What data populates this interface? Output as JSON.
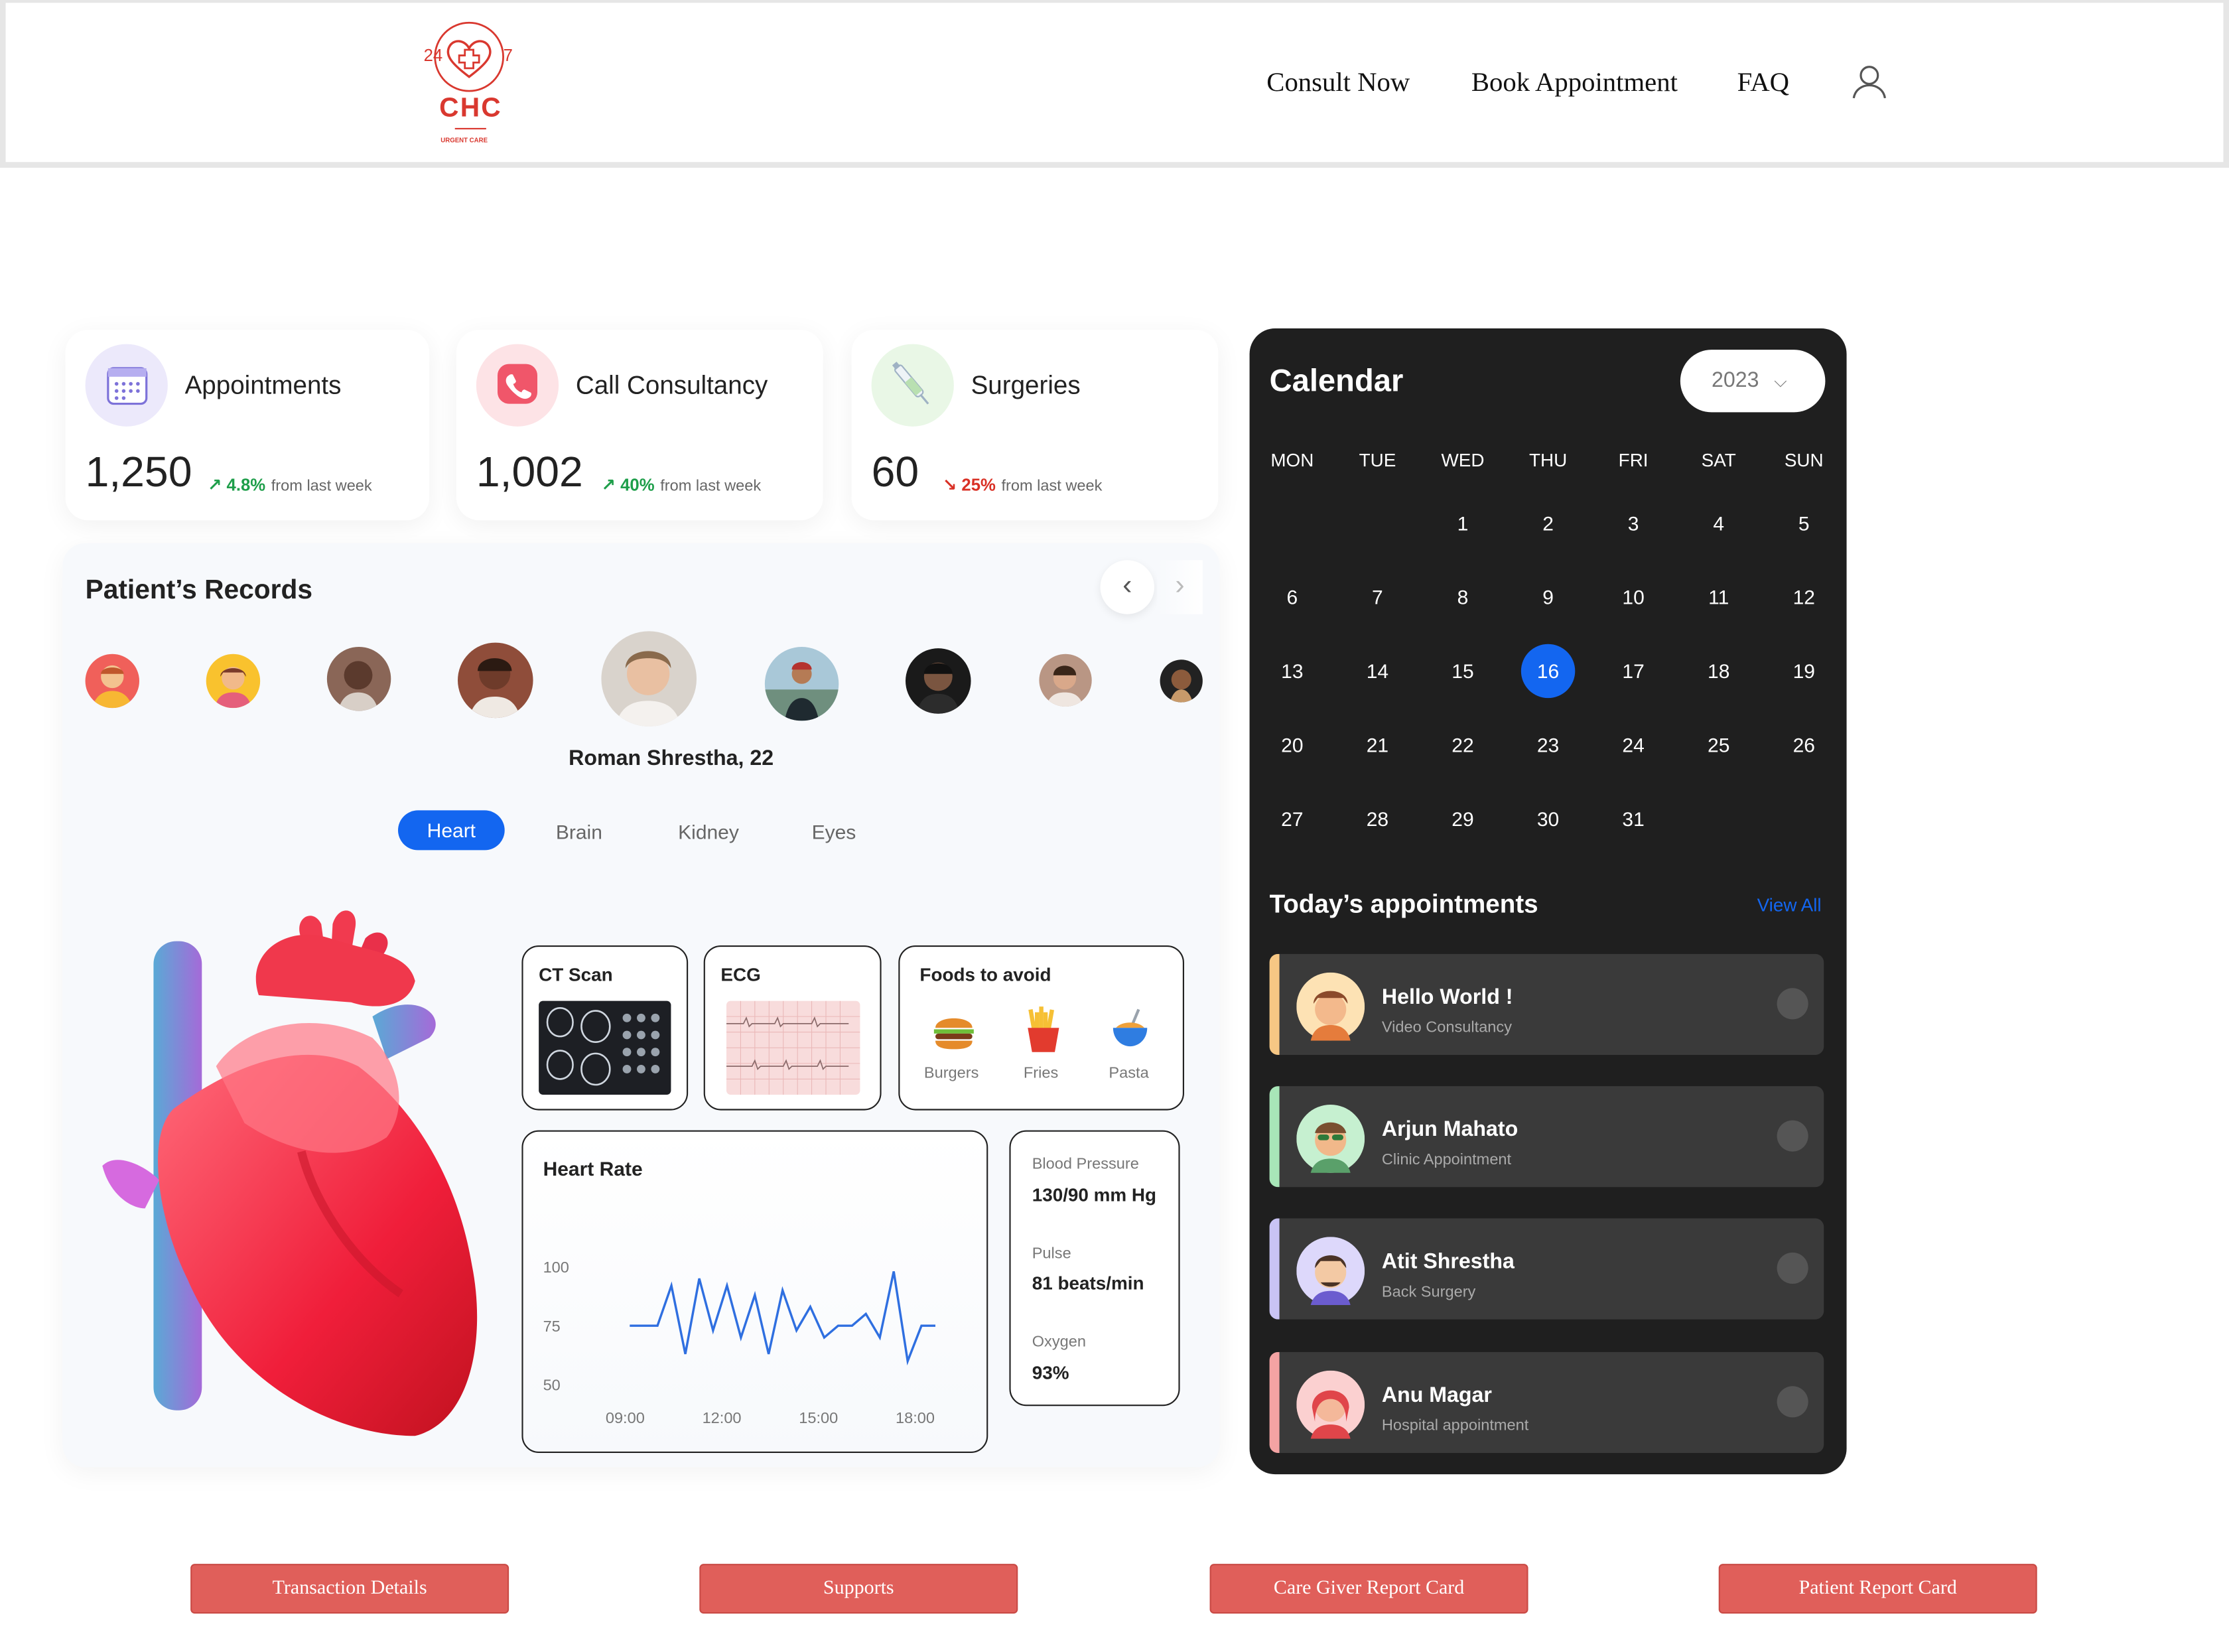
{
  "header": {
    "logo": {
      "top_left": "24",
      "top_right": "7",
      "brand": "CHC",
      "tagline": "URGENT CARE"
    },
    "nav": [
      "Consult Now",
      "Book Appointment",
      "FAQ"
    ],
    "user_icon": "user-icon"
  },
  "stats": [
    {
      "label": "Appointments",
      "value": "1,250",
      "change": "4.8%",
      "direction": "up",
      "note": "from last week",
      "icon": "calendar-icon",
      "color": "#1e9e4a"
    },
    {
      "label": "Call Consultancy",
      "value": "1,002",
      "change": "40%",
      "direction": "up",
      "note": "from last week",
      "icon": "phone-icon",
      "color": "#1e9e4a"
    },
    {
      "label": "Surgeries",
      "value": "60",
      "change": "25%",
      "direction": "down",
      "note": "from last week",
      "icon": "syringe-icon",
      "color": "#d93025"
    }
  ],
  "records": {
    "title": "Patient’s Records",
    "selected_patient": "Roman Shrestha, 22",
    "tabs": [
      "Heart",
      "Brain",
      "Kidney",
      "Eyes"
    ],
    "active_tab": "Heart",
    "ct_scan": "CT Scan",
    "ecg": "ECG",
    "foods": {
      "title": "Foods to avoid",
      "items": [
        "Burgers",
        "Fries",
        "Pasta"
      ]
    },
    "heart_rate": {
      "title": "Heart Rate"
    },
    "vitals": [
      {
        "label": "Blood Pressure",
        "value": "130/90 mm Hg"
      },
      {
        "label": "Pulse",
        "value": "81 beats/min"
      },
      {
        "label": "Oxygen",
        "value": "93%"
      }
    ]
  },
  "chart_data": {
    "type": "line",
    "title": "Heart Rate",
    "x_ticks": [
      "09:00",
      "12:00",
      "15:00",
      "18:00"
    ],
    "y_ticks": [
      100,
      75,
      50
    ],
    "ylim": [
      50,
      100
    ],
    "series": [
      {
        "values": [
          75,
          75,
          75,
          92,
          63,
          95,
          73,
          92,
          70,
          88,
          63,
          90,
          73,
          83,
          70,
          75,
          75,
          80,
          70,
          98,
          60,
          75,
          75
        ]
      }
    ],
    "line_color": "#2f6fe0"
  },
  "calendar": {
    "title": "Calendar",
    "year": "2023",
    "weekdays": [
      "MON",
      "TUE",
      "WED",
      "THU",
      "FRI",
      "SAT",
      "SUN"
    ],
    "start_offset": 2,
    "days_in_month": 31,
    "selected_day": 16,
    "accent": "#1366f0"
  },
  "appointments": {
    "title": "Today’s appointments",
    "view_all": "View All",
    "items": [
      {
        "name": "Hello World !",
        "type": "Video Consultancy",
        "color": "#f6c784"
      },
      {
        "name": "Arjun Mahato",
        "type": "Clinic Appointment",
        "color": "#a8e6b8"
      },
      {
        "name": "Atit Shrestha",
        "type": "Back Surgery",
        "color": "#c9c3f4"
      },
      {
        "name": "Anu Magar",
        "type": "Hospital appointment",
        "color": "#f4a3a3"
      }
    ]
  },
  "footer_buttons": [
    "Transaction Details",
    "Supports",
    "Care Giver Report Card",
    "Patient Report Card"
  ]
}
